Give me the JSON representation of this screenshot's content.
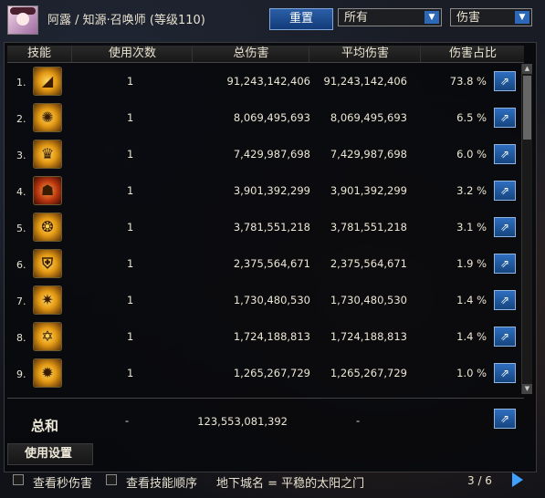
{
  "header": {
    "character": "阿露 / 知源·召唤师 (等级110)",
    "reset_label": "重置",
    "filter_value": "所有",
    "metric_value": "伤害"
  },
  "table": {
    "columns": [
      "技能",
      "使用次数",
      "总伤害",
      "平均伤害",
      "伤害占比"
    ],
    "rows": [
      {
        "index": "1.",
        "icon": "horn-skill-icon",
        "uses": "1",
        "total": "91,243,142,406",
        "avg": "91,243,142,406",
        "pct": "73.8  %"
      },
      {
        "index": "2.",
        "icon": "sun-rune-skill-icon",
        "uses": "1",
        "total": "8,069,495,693",
        "avg": "8,069,495,693",
        "pct": "6.5  %"
      },
      {
        "index": "3.",
        "icon": "crown-skill-icon",
        "uses": "1",
        "total": "7,429,987,698",
        "avg": "7,429,987,698",
        "pct": "6.0  %"
      },
      {
        "index": "4.",
        "icon": "demon-face-skill-icon",
        "uses": "1",
        "total": "3,901,392,299",
        "avg": "3,901,392,299",
        "pct": "3.2  %"
      },
      {
        "index": "5.",
        "icon": "fire-spirit-skill-icon",
        "uses": "1",
        "total": "3,781,551,218",
        "avg": "3,781,551,218",
        "pct": "3.1  %"
      },
      {
        "index": "6.",
        "icon": "shield-skill-icon",
        "uses": "1",
        "total": "2,375,564,671",
        "avg": "2,375,564,671",
        "pct": "1.9  %"
      },
      {
        "index": "7.",
        "icon": "star-burst-skill-icon",
        "uses": "1",
        "total": "1,730,480,530",
        "avg": "1,730,480,530",
        "pct": "1.4  %"
      },
      {
        "index": "8.",
        "icon": "hex-rune-skill-icon",
        "uses": "1",
        "total": "1,724,188,813",
        "avg": "1,724,188,813",
        "pct": "1.4  %"
      },
      {
        "index": "9.",
        "icon": "flame-rune-skill-icon",
        "uses": "1",
        "total": "1,265,267,729",
        "avg": "1,265,267,729",
        "pct": "1.0  %"
      }
    ]
  },
  "totals": {
    "label": "总和",
    "uses": "-",
    "total": "123,553,081,392",
    "avg": "-"
  },
  "settings_label": "使用设置",
  "footer": {
    "check_instant": "查看秒伤害",
    "check_order": "查看技能顺序",
    "dungeon": "地下城名 = 平稳的太阳之门",
    "page": "3 / 6"
  }
}
